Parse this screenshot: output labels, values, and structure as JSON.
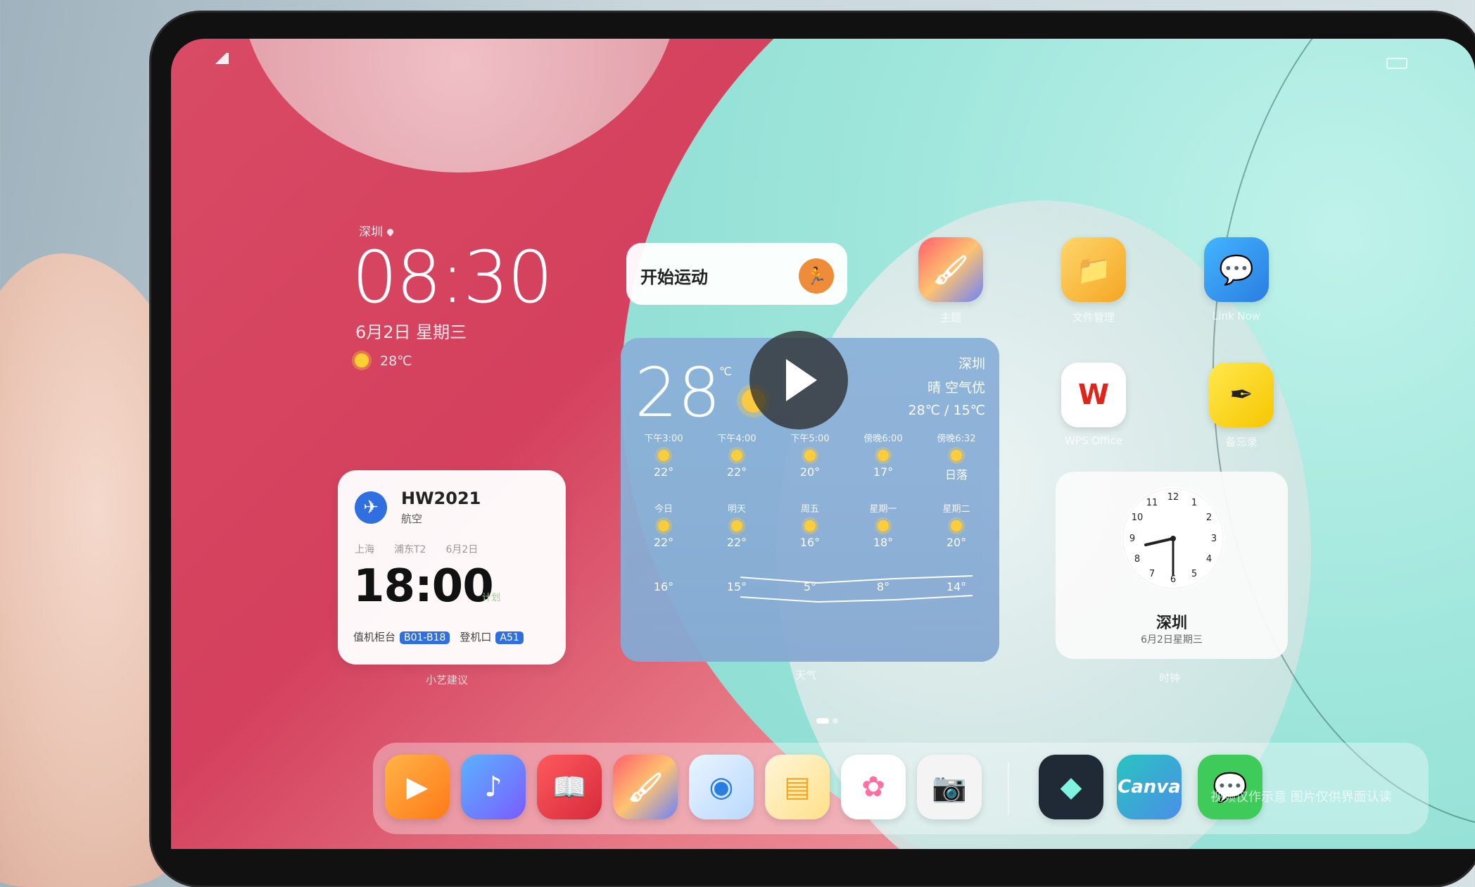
{
  "status_bar": {},
  "lock_widget": {
    "location": "深圳",
    "time": "08:30",
    "date": "6月2日 星期三",
    "temp": "28℃"
  },
  "flight_card": {
    "flight_no": "HW2021",
    "airline": "航空",
    "from": "上海",
    "terminal": "浦东T2",
    "date": "6月2日",
    "time": "18:00",
    "status": "计划",
    "checkin_label": "值机柜台",
    "checkin_value": "B01-B18",
    "gate_label": "登机口",
    "gate_value": "A51",
    "caption": "小艺建议"
  },
  "sport_card": {
    "label": "开始运动"
  },
  "weather": {
    "temp": "28",
    "unit": "℃",
    "city": "深圳",
    "condition": "晴  空气优",
    "range": "28℃ / 15℃",
    "caption": "天气",
    "hourly": [
      {
        "label": "下午3:00",
        "value": "22°"
      },
      {
        "label": "下午4:00",
        "value": "22°"
      },
      {
        "label": "下午5:00",
        "value": "20°"
      },
      {
        "label": "傍晚6:00",
        "value": "17°"
      },
      {
        "label": "傍晚6:32",
        "value": "日落"
      }
    ],
    "daily": [
      {
        "label": "今日",
        "high": "22°",
        "low": "16°"
      },
      {
        "label": "明天",
        "high": "22°",
        "low": "15°"
      },
      {
        "label": "周五",
        "high": "16°",
        "low": "5°"
      },
      {
        "label": "星期一",
        "high": "18°",
        "low": "8°"
      },
      {
        "label": "星期二",
        "high": "20°",
        "low": "14°"
      }
    ]
  },
  "apps": {
    "huawei_art": "主题",
    "files": "文件管理",
    "link_now": "Link Now",
    "wps": "WPS Office",
    "notes": "备忘录"
  },
  "clock_card": {
    "city": "深圳",
    "date": "6月2日星期三",
    "caption": "时钟"
  },
  "watermark": "视频仅作示意  图片仅供界面认读",
  "colors": {
    "wall_red": "#d94a64",
    "wall_teal": "#9fe6dc",
    "weather_blue": "#8bb1d9",
    "flight_blue": "#2f6fe0",
    "sport_orange": "#ef8c3a"
  }
}
